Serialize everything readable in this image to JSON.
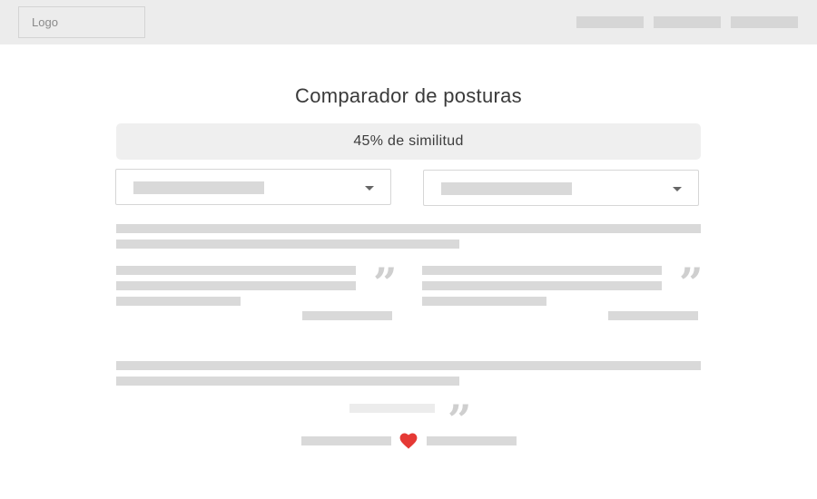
{
  "header": {
    "logo_text": "Logo",
    "nav_items": [
      "",
      "",
      ""
    ]
  },
  "main": {
    "title": "Comparador de posturas",
    "similarity_label": "45% de similitud",
    "similarity_value": 45,
    "selects": [
      {
        "selected": ""
      },
      {
        "selected": ""
      }
    ]
  },
  "icons": {
    "quote": "closing-quote-icon",
    "heart": "heart-icon",
    "caret": "chevron-down-icon"
  },
  "colors": {
    "accent": "#e53935",
    "header_bg": "#ececec",
    "placeholder": "#d9d9d9"
  }
}
